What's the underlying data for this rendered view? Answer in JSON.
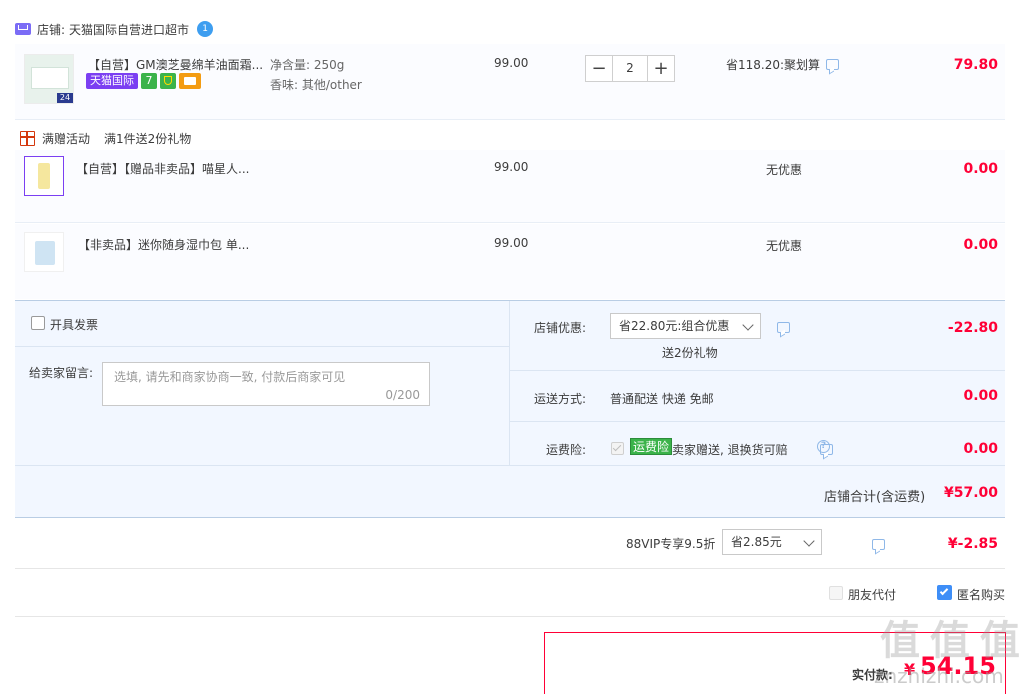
{
  "shop": {
    "label": "店铺:",
    "name": "天猫国际自营进口超市",
    "badge": "1"
  },
  "items": [
    {
      "title": "【自营】GM澳芝曼绵羊油面霜...",
      "sku1": "净含量: 250g",
      "sku2": "香味: 其他/other",
      "price": "99.00",
      "quantity": "2",
      "discount": "省118.20:聚划算",
      "total": "79.80",
      "tag_tmall": "天猫国际",
      "tag_7": "7"
    },
    {
      "title": "【自营】【赠品非卖品】喵星人...",
      "price": "99.00",
      "discount": "无优惠",
      "total": "0.00"
    },
    {
      "title": "【非卖品】迷你随身湿巾包 单...",
      "price": "99.00",
      "discount": "无优惠",
      "total": "0.00"
    }
  ],
  "gift": {
    "label": "满赠活动",
    "text": "满1件送2份礼物"
  },
  "invoice": {
    "label": "开具发票"
  },
  "message": {
    "label": "给卖家留言:",
    "placeholder": "选填, 请先和商家协商一致, 付款后商家可见",
    "counter": "0/200"
  },
  "shop_discount": {
    "label": "店铺优惠:",
    "selected": "省22.80元:组合优惠",
    "sub": "送2份礼物",
    "amount": "-22.80"
  },
  "shipping": {
    "label": "运送方式:",
    "value": "普通配送 快递 免邮",
    "amount": "0.00"
  },
  "insurance": {
    "label": "运费险:",
    "badge": "运费险",
    "text": "卖家赠送, 退换货可赔",
    "amount": "0.00"
  },
  "shop_total": {
    "label": "店铺合计(含运费)",
    "amount": "¥57.00"
  },
  "vip": {
    "label": "88VIP专享9.5折",
    "selected": "省2.85元",
    "amount": "¥-2.85"
  },
  "options": {
    "friend_pay": "朋友代付",
    "anonymous": "匿名购买"
  },
  "final": {
    "label": "实付款:",
    "currency": "¥",
    "amount": "54.15"
  },
  "watermark": "值 值 值",
  "watermark_url": "znzhizhi.com",
  "colors": {
    "accent_red": "#ff0036",
    "tmall_purple": "#7b3ff2",
    "insurance_green": "#3bb34a",
    "row_bg": "#fbfcff",
    "section_bg": "#f2f7ff"
  }
}
